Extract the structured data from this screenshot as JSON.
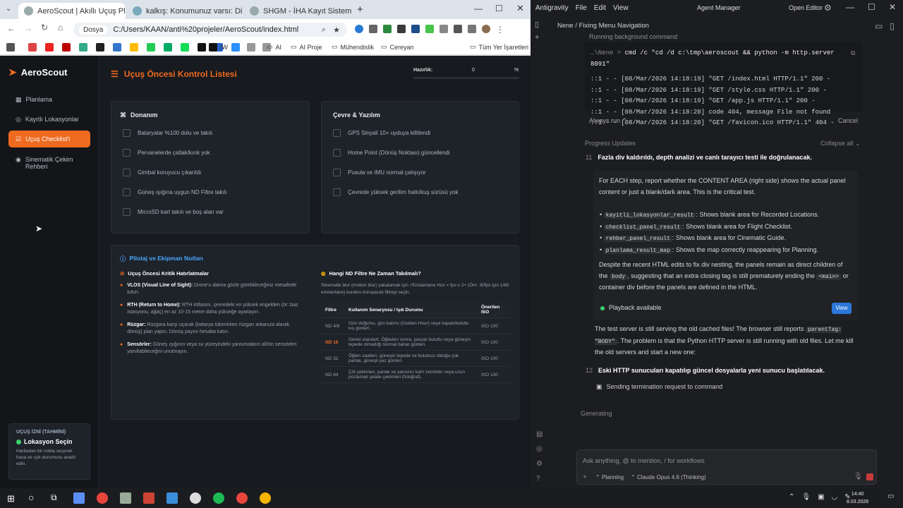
{
  "browser": {
    "tabs": [
      "AeroScout | Akıllı Uçuş Planlayı",
      "kalkış: Konumunuz varsı: Diama",
      "SHGM - İHA Kayıt Sistemi"
    ],
    "url_chip": "Dosya",
    "url": "C:/Users/KAAN/anti%20projeler/AeroScout/index.html",
    "bookmarks": [
      "tW",
      "AI",
      "AI Proje",
      "Mühendislik",
      "Cereyan",
      "Tüm Yer İşaretleri"
    ]
  },
  "app": {
    "brand": "AeroScout",
    "nav": [
      "Planlama",
      "Kayıtlı Lokasyonlar",
      "Uçuş Checklist'i",
      "Sinematik Çekim Rehberi"
    ],
    "page_title": "Uçuş Öncesi Kontrol Listesi",
    "ready_label": "Hazırlık:",
    "ready_value": "0",
    "ready_unit": "%",
    "hardware_title": "Donanım",
    "hardware_items": [
      "Bataryalar %100 dolu ve takılı",
      "Pervanelerde çatlak/kırık yok",
      "Gimbal koruyucu çıkarıldı",
      "Güneş ışığına uygun ND Filtre takılı",
      "MicroSD kart takılı ve boş alan var"
    ],
    "env_title": "Çevre & Yazılım",
    "env_items": [
      "GPS Sinyali 10+ uyduya kilitlendi",
      "Home Point (Dönüş Noktası) güncellendi",
      "Pusula ve IMU normal çalışıyor",
      "Çevrede yüksek gerilim hattı/kuş sürüsü yok"
    ],
    "notes_title": "Pilotaj ve Ekipman Notları",
    "critical_title": "Uçuş Öncesi Kritik Hatırlatmalar",
    "critical": [
      {
        "k": "VLOS (Visual Line of Sight):",
        "v": " Drone'u daima gözle görebileceğiniz mesafede tutun."
      },
      {
        "k": "RTH (Return to Home):",
        "v": " RTH irtifasını, çevredeki en yüksek engelden (ör: baz istasyonu, ağaç) en az 10-15 metre daha yükseğe ayarlayın."
      },
      {
        "k": "Rüzgar:",
        "v": " Rüzgara karşı uçarak (batarya tükenirken rüzgarı arkanıza alarak dönüş) plan yapın. Dönüş payını hesaba katın."
      },
      {
        "k": "Sensörler:",
        "v": " Güneş ışığının veya su yüzeyindeki yansımaların alt/ön sensörleri yanıltabileceğini unutmayın."
      }
    ],
    "nd_title": "Hangi ND Filtre Ne Zaman Takılmalı?",
    "nd_desc": "Sinematik blur (motion blur) yakalamak için +Enstantane Hızı = fps x 2+ (Örn: 30fps için 1/60 enstantane) kuralını koruyacak filtreyi seçin.",
    "nd_headers": [
      "Filtre",
      "Kullanım Senaryosu / Işık Durumu",
      "Önerilen ISO"
    ],
    "nd_rows": [
      [
        "ND 4/8",
        "Gün doğumu, gün batımı (Golden Hour) veya kapalı/bulutlu kış günleri.",
        "ISO 100"
      ],
      [
        "ND 16",
        "Genel standart. Öğleden sonra, parçalı bulutlu veya güneşin tepede olmadığı normal bahar günleri.",
        "ISO 100"
      ],
      [
        "ND 32",
        "Öğlen saatleri, güneşin tepede ve bulutsuz olduğu çok parlak, güneşli yaz günleri.",
        "ISO 100"
      ],
      [
        "ND 64",
        "Çöl çekimleri, parlak ve yansıtıcı karlı zeminler veya uzun pozlamalı şelale çekimleri (fotoğraf).",
        "ISO 100"
      ]
    ],
    "permit_label": "UÇUŞ İZNİ (TAHMİNİ)",
    "permit_status": "Lokasyon Seçin",
    "permit_desc": "Haritadan bir nokta seçerek hava ve ışık durumunu analiz edin."
  },
  "ide": {
    "menu": [
      "Antigravity",
      "File",
      "Edit",
      "View"
    ],
    "agent_manager": "Agent Manager",
    "open_editor": "Open Editor",
    "breadcrumb": "Nene / Fixing Menu Navigation",
    "running": "Running background command",
    "cmd_prompt": "…\\Nene > ",
    "cmd": "cmd /c \"cd /d c:\\tmp\\aeroscout && python -m http.server 8091\"",
    "log": [
      "::1 - - [08/Mar/2026 14:18:19] \"GET /index.html HTTP/1.1\" 200 -",
      "::1 - - [08/Mar/2026 14:18:19] \"GET /style.css HTTP/1.1\" 200 -",
      "::1 - - [08/Mar/2026 14:18:19] \"GET /app.js HTTP/1.1\" 200 -",
      "::1 - - [08/Mar/2026 14:18:20] code 404, message File not found",
      "::1 - - [08/Mar/2026 14:18:20] \"GET /favicon.ico HTTP/1.1\" 404 -"
    ],
    "always_run": "Always run",
    "cancel": "Cancel",
    "progress": "Progress Updates",
    "collapse": "Collapse all",
    "step11_num": "11",
    "step11": "Fazla div kaldırıldı, depth analizi ve canlı tarayıcı testi ile doğrulanacak.",
    "para1": "For EACH step, report whether the CONTENT AREA (right side) shows the actual panel content or just a blank/dark area. This is the critical test.",
    "bullets": [
      {
        "c": "kayitli_lokasyonlar_result",
        "t": ": Shows blank area for Recorded Locations."
      },
      {
        "c": "checklist_panel_result",
        "t": ": Shows blank area for Flight Checklist."
      },
      {
        "c": "rehber_panel_result",
        "t": ": Shows blank area for Cinematic Guide."
      },
      {
        "c": "planlama_result_map",
        "t": ": Shows the map correctly reappearing for Planning."
      }
    ],
    "para2a": "Despite the recent HTML edits to fix div nesting, the panels remain as direct children of the ",
    "para2b": "body",
    "para2c": ", suggesting that an extra closing tag is still prematurely ending the ",
    "para2d": "<main>",
    "para2e": " or container div before the panels are defined in the HTML.",
    "playback": "Playback available",
    "view": "View",
    "para3a": "The test server is still serving the old cached files! The browser still reports ",
    "para3b": "parentTag: \"BODY\"",
    "para3c": ". The problem is that the Python HTTP server is still running with old files. Let me kill the old servers and start a new one:",
    "step12_num": "12",
    "step12": "Eski HTTP sunucuları kapatılıp güncel dosyalarla yeni sunucu başlatılacak.",
    "sending": "Sending termination request to command",
    "generating": "Generating",
    "input_placeholder": "Ask anything, @ to mention, / for workflows",
    "mode": "Planning",
    "model": "Claude Opus 4.6 (Thinking)"
  },
  "taskbar": {
    "time": "14:40",
    "date": "8.03.2026"
  }
}
